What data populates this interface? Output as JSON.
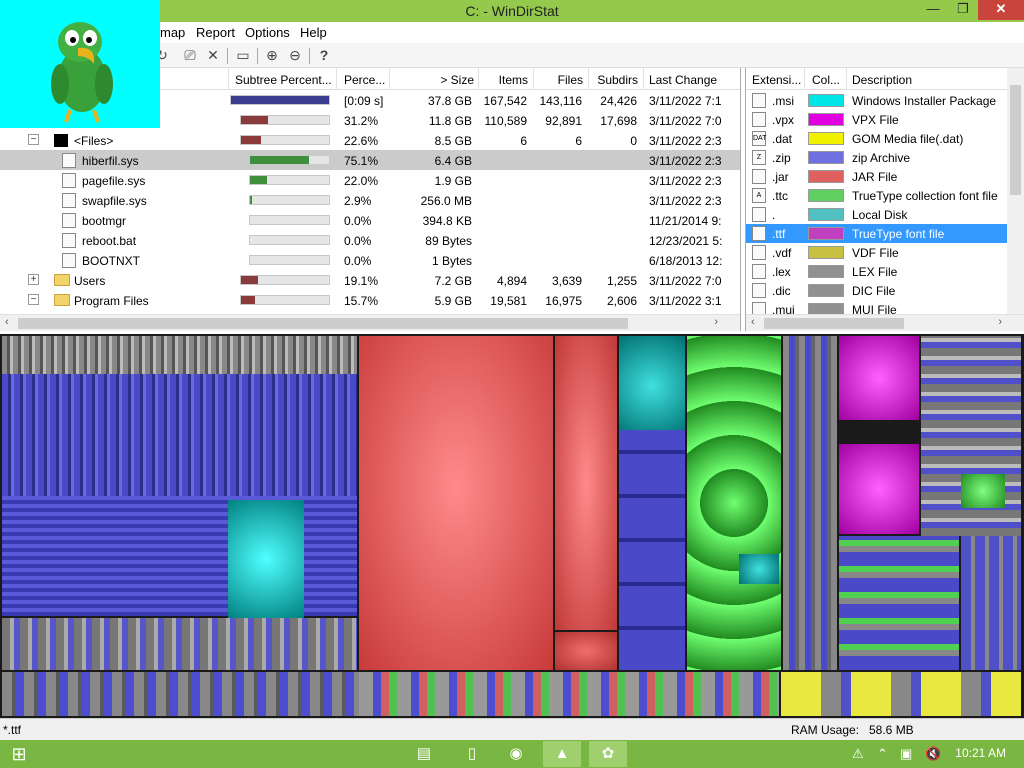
{
  "window": {
    "title": "C: - WinDirStat",
    "min": "—",
    "max": "❐",
    "close": "✕"
  },
  "menu": [
    "map",
    "Report",
    "Options",
    "Help"
  ],
  "toolbar": [
    "↻",
    "⎚",
    "✕",
    "▭",
    "⊕",
    "⊖",
    "?"
  ],
  "tree": {
    "headers": [
      "Subtree Percent...",
      "Perce...",
      "> Size",
      "Items",
      "Files",
      "Subdirs",
      "Last Change"
    ],
    "rows": [
      {
        "name": "",
        "bar_pct": 100,
        "bar_color": "#3b3b8f",
        "perc": "[0:09 s]",
        "size": "37.8 GB",
        "items": "167,542",
        "files": "143,116",
        "subdirs": "24,426",
        "date": "3/11/2022 7:1"
      },
      {
        "name": "",
        "bar_pct": 31.2,
        "bar_color": "#8a3a3a",
        "perc": "31.2%",
        "size": "11.8 GB",
        "items": "110,589",
        "files": "92,891",
        "subdirs": "17,698",
        "date": "3/11/2022 7:0"
      },
      {
        "name": "<Files>",
        "bar_pct": 22.6,
        "bar_color": "#8a3a3a",
        "perc": "22.6%",
        "size": "8.5 GB",
        "items": "6",
        "files": "6",
        "subdirs": "0",
        "date": "3/11/2022 2:3"
      },
      {
        "name": "hiberfil.sys",
        "bar_pct": 75.1,
        "bar_color": "#3f8f3f",
        "perc": "75.1%",
        "size": "6.4 GB",
        "items": "",
        "files": "",
        "subdirs": "",
        "date": "3/11/2022 2:3"
      },
      {
        "name": "pagefile.sys",
        "bar_pct": 22.0,
        "bar_color": "#3f8f3f",
        "perc": "22.0%",
        "size": "1.9 GB",
        "items": "",
        "files": "",
        "subdirs": "",
        "date": "3/11/2022 2:3"
      },
      {
        "name": "swapfile.sys",
        "bar_pct": 2.9,
        "bar_color": "#3f8f3f",
        "perc": "2.9%",
        "size": "256.0 MB",
        "items": "",
        "files": "",
        "subdirs": "",
        "date": "3/11/2022 2:3"
      },
      {
        "name": "bootmgr",
        "bar_pct": 0,
        "bar_color": "#3f8f3f",
        "perc": "0.0%",
        "size": "394.8 KB",
        "items": "",
        "files": "",
        "subdirs": "",
        "date": "11/21/2014 9:"
      },
      {
        "name": "reboot.bat",
        "bar_pct": 0,
        "bar_color": "#3f8f3f",
        "perc": "0.0%",
        "size": "89 Bytes",
        "items": "",
        "files": "",
        "subdirs": "",
        "date": "12/23/2021 5:"
      },
      {
        "name": "BOOTNXT",
        "bar_pct": 0,
        "bar_color": "#3f8f3f",
        "perc": "0.0%",
        "size": "1 Bytes",
        "items": "",
        "files": "",
        "subdirs": "",
        "date": "6/18/2013 12:"
      },
      {
        "name": "Users",
        "bar_pct": 19.1,
        "bar_color": "#8a3a3a",
        "perc": "19.1%",
        "size": "7.2 GB",
        "items": "4,894",
        "files": "3,639",
        "subdirs": "1,255",
        "date": "3/11/2022 7:0"
      },
      {
        "name": "Program Files",
        "bar_pct": 15.7,
        "bar_color": "#8a3a3a",
        "perc": "15.7%",
        "size": "5.9 GB",
        "items": "19,581",
        "files": "16,975",
        "subdirs": "2,606",
        "date": "3/11/2022 3:1"
      }
    ]
  },
  "extensions": {
    "headers": [
      "Extensi...",
      "Col...",
      "Description"
    ],
    "rows": [
      {
        "ext": ".msi",
        "color": "#00e5e5",
        "desc": "Windows Installer Package",
        "icon": ""
      },
      {
        "ext": ".vpx",
        "color": "#e000e0",
        "desc": "VPX File",
        "icon": ""
      },
      {
        "ext": ".dat",
        "color": "#f0f000",
        "desc": "GOM Media file(.dat)",
        "icon": "DAT"
      },
      {
        "ext": ".zip",
        "color": "#7070e0",
        "desc": "zip Archive",
        "icon": "Z"
      },
      {
        "ext": ".jar",
        "color": "#e06060",
        "desc": "JAR File",
        "icon": ""
      },
      {
        "ext": ".ttc",
        "color": "#60d060",
        "desc": "TrueType collection font file",
        "icon": "A"
      },
      {
        "ext": ".",
        "color": "#50c0c0",
        "desc": "Local Disk",
        "icon": ""
      },
      {
        "ext": ".ttf",
        "color": "#c040c0",
        "desc": "TrueType font file",
        "icon": "A"
      },
      {
        "ext": ".vdf",
        "color": "#c8c040",
        "desc": "VDF File",
        "icon": ""
      },
      {
        "ext": ".lex",
        "color": "#909090",
        "desc": "LEX File",
        "icon": ""
      },
      {
        "ext": ".dic",
        "color": "#909090",
        "desc": "DIC File",
        "icon": ""
      },
      {
        "ext": ".mui",
        "color": "#909090",
        "desc": "MUI File",
        "icon": ""
      }
    ]
  },
  "status": {
    "left": "*.ttf",
    "ram_label": "RAM Usage:",
    "ram_value": "58.6 MB"
  },
  "taskbar": {
    "clock": "10:21 AM"
  },
  "colors": {
    "accent": "#94c94b",
    "taskbar": "#7ab742",
    "selection": "#3399ff"
  }
}
